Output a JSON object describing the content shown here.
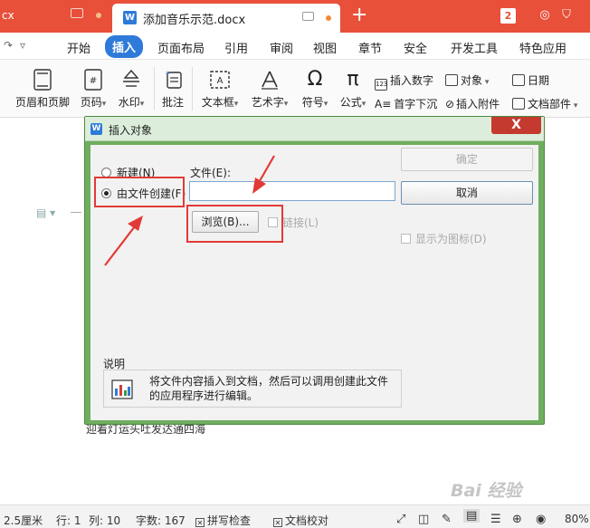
{
  "tabs": {
    "prev_tab_label": "cx",
    "active_tab_label": "添加音乐示范.docx",
    "window_count": "2"
  },
  "menu": {
    "items": [
      "开始",
      "插入",
      "页面布局",
      "引用",
      "审阅",
      "视图",
      "章节",
      "安全",
      "开发工具",
      "特色应用"
    ],
    "active": "插入"
  },
  "ribbon": {
    "header_footer": "页眉和页脚",
    "page_number": "页码",
    "watermark": "水印",
    "comment": "批注",
    "textbox": "文本框",
    "art_text": "艺术字",
    "symbol": "符号",
    "formula": "公式",
    "insert_number": "插入数字",
    "object": "对象",
    "date": "日期",
    "drop_cap": "首字下沉",
    "insert_attachment": "插入附件",
    "doc_parts": "文档部件"
  },
  "document": {
    "visible_text": "迎着灯运头吐发达通四海"
  },
  "dialog": {
    "title": "插入对象",
    "close_label": "X",
    "radio_new": "新建(N)",
    "radio_from_file": "由文件创建(F)",
    "file_label": "文件(E):",
    "file_value": "",
    "browse_label": "浏览(B)...",
    "link_label": "链接(L)",
    "ok_label": "确定",
    "cancel_label": "取消",
    "display_as_icon_label": "显示为图标(D)",
    "description_title": "说明",
    "description_text": "将文件内容插入到文档，然后可以调用创建此文件的应用程序进行编辑。",
    "selected_option": "由文件创建(F)"
  },
  "status_bar": {
    "position": "2.5厘米",
    "row": "行: 1",
    "col": "列: 10",
    "word_count": "字数: 167",
    "spell_check": "拼写检查",
    "doc_proof": "文档校对",
    "zoom": "80%"
  },
  "watermark_text": "Bai 经验",
  "colors": {
    "title_bar": "#e8503a",
    "accent_blue": "#2e7ad9",
    "dialog_frame": "#6fae5f",
    "annotation_red": "#e23a36"
  }
}
